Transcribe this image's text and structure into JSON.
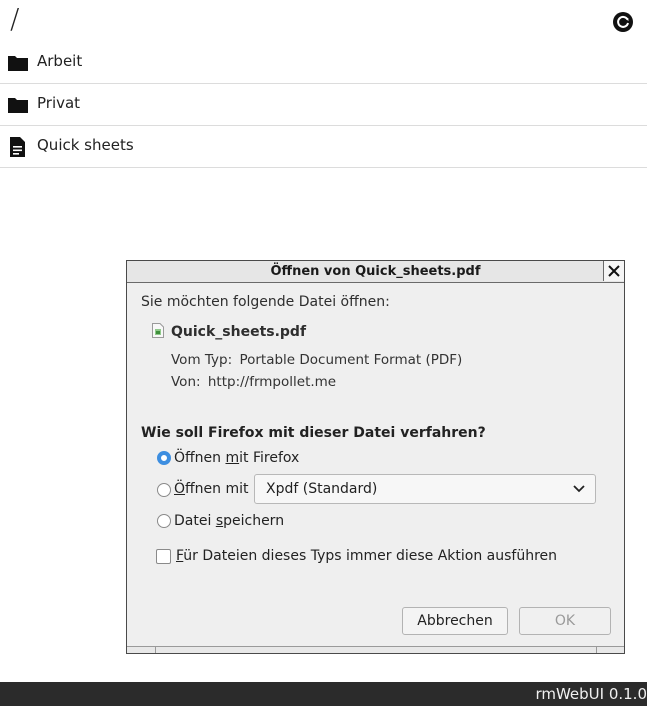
{
  "header": {
    "path": "/",
    "refresh_icon": "refresh-icon"
  },
  "files": [
    {
      "label": "Arbeit",
      "icon": "folder-icon"
    },
    {
      "label": "Privat",
      "icon": "folder-icon"
    },
    {
      "label": "Quick sheets",
      "icon": "document-icon"
    }
  ],
  "dialog": {
    "title": "Öffnen von Quick_sheets.pdf",
    "intro": "Sie möchten folgende Datei öffnen:",
    "filename": "Quick_sheets.pdf",
    "type_key": "Vom Typ:",
    "type_value": "Portable Document Format (PDF)",
    "from_key": "Von:",
    "from_value": "http://frmpollet.me",
    "question": "Wie soll Firefox mit dieser Datei verfahren?",
    "open_with_firefox": {
      "pre": "Öffnen ",
      "u": "m",
      "post": "it Firefox",
      "checked": true
    },
    "open_with": {
      "pre": "",
      "u": "Ö",
      "post": "ffnen mit",
      "checked": false
    },
    "open_with_app": "Xpdf (Standard)",
    "save_file": {
      "pre": "Datei ",
      "u": "s",
      "post": "peichern",
      "checked": false
    },
    "always": {
      "pre": "",
      "u": "F",
      "post": "ür Dateien dieses Typs immer diese Aktion ausführen",
      "checked": false
    },
    "cancel_label": "Abbrechen",
    "ok_label": "OK",
    "accent_color": "#3d8ee0"
  },
  "footer": {
    "version": "rmWebUI 0.1.0"
  }
}
